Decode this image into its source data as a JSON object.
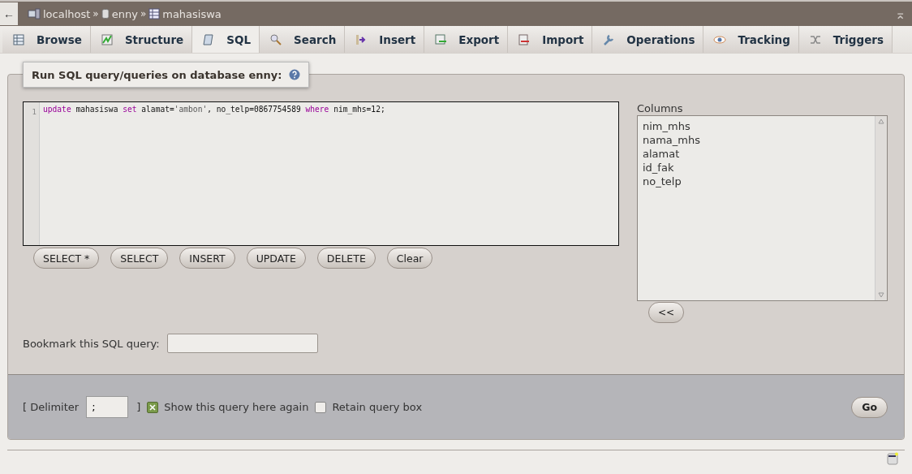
{
  "breadcrumb": [
    {
      "label": "localhost",
      "kind": "server"
    },
    {
      "label": "enny",
      "kind": "database"
    },
    {
      "label": "mahasiswa",
      "kind": "table"
    }
  ],
  "breadcrumb_separator": "»",
  "back_button": "←",
  "collapse_button": "⌅",
  "tabs": [
    {
      "label": "Browse",
      "selected": false
    },
    {
      "label": "Structure",
      "selected": false
    },
    {
      "label": "SQL",
      "selected": true
    },
    {
      "label": "Search",
      "selected": false
    },
    {
      "label": "Insert",
      "selected": false
    },
    {
      "label": "Export",
      "selected": false
    },
    {
      "label": "Import",
      "selected": false
    },
    {
      "label": "Operations",
      "selected": false
    },
    {
      "label": "Tracking",
      "selected": false
    },
    {
      "label": "Triggers",
      "selected": false
    }
  ],
  "legend": "Run SQL query/queries on database enny:",
  "editor": {
    "line_number": "1",
    "tokens": [
      {
        "text": "update",
        "kind": "keyword"
      },
      {
        "text": " mahasiswa ",
        "kind": "plain"
      },
      {
        "text": "set",
        "kind": "keyword"
      },
      {
        "text": " alamat=",
        "kind": "plain"
      },
      {
        "text": "'ambon'",
        "kind": "string"
      },
      {
        "text": ", no_telp=0867754589 ",
        "kind": "plain"
      },
      {
        "text": "where",
        "kind": "keyword"
      },
      {
        "text": " nim_mhs=12;",
        "kind": "plain"
      }
    ]
  },
  "query_buttons": [
    "SELECT *",
    "SELECT",
    "INSERT",
    "UPDATE",
    "DELETE",
    "Clear"
  ],
  "columns": {
    "label": "Columns",
    "items": [
      "nim_mhs",
      "nama_mhs",
      "alamat",
      "id_fak",
      "no_telp"
    ],
    "insert_button": "<<"
  },
  "bookmark": {
    "label": "Bookmark this SQL query:"
  },
  "footer": {
    "delimiter_open": "[ Delimiter",
    "delimiter_value": ";",
    "delimiter_close": "]",
    "options": [
      {
        "label": "Show this query here again",
        "checked": true
      },
      {
        "label": "Retain query box",
        "checked": false
      }
    ],
    "go_button": "Go"
  }
}
